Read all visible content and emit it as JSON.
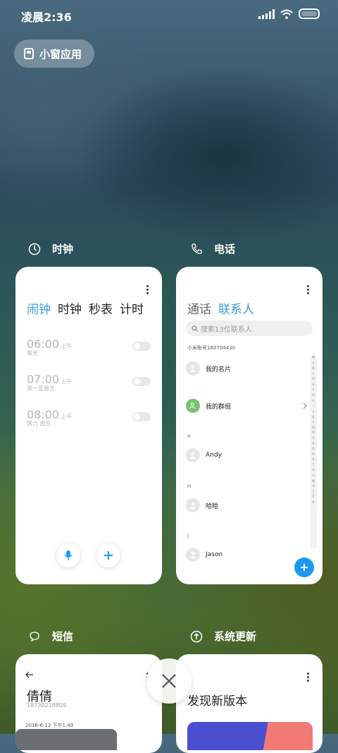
{
  "status_bar": {
    "time": "凌晨2:36"
  },
  "floating_window": {
    "label": "小窗应用",
    "icon": "small-window-icon"
  },
  "colors": {
    "accent": "#3a9bdc",
    "fab": "#1a9aef",
    "contact_group": "#78c26f"
  },
  "cards": {
    "clock": {
      "title": "时钟",
      "icon": "clock-icon",
      "tabs": [
        "闹钟",
        "时钟",
        "秒表",
        "计时"
      ],
      "active_tab": "闹钟",
      "alarms": [
        {
          "time": "06:00",
          "ampm": "上午",
          "repeat": "每天",
          "enabled": false
        },
        {
          "time": "07:00",
          "ampm": "上午",
          "repeat": "周一至周五",
          "enabled": false
        },
        {
          "time": "08:00",
          "ampm": "上午",
          "repeat": "周六 周日",
          "enabled": false
        }
      ]
    },
    "phone": {
      "title": "电话",
      "icon": "phone-icon",
      "tabs": [
        "通话",
        "联系人"
      ],
      "active_tab": "联系人",
      "search_placeholder": "搜索13位联系人",
      "account": "小米账号183704430",
      "contacts": [
        {
          "letter": "",
          "name": "我的名片"
        },
        {
          "letter": "",
          "name": "我的群组"
        },
        {
          "letter": "A",
          "name": "Andy"
        },
        {
          "letter": "H",
          "name": "哈哈"
        },
        {
          "letter": "J",
          "name": "Jason"
        }
      ],
      "index_letters": [
        "♥",
        "A",
        "B",
        "C",
        "D",
        "E",
        "F",
        "G",
        "H",
        "I",
        "J",
        "K",
        "L",
        "M",
        "N",
        "O",
        "P",
        "Q",
        "R",
        "S",
        "T",
        "U",
        "V",
        "W",
        "X",
        "Y",
        "Z",
        "#"
      ]
    },
    "sms": {
      "title": "短信",
      "icon": "message-icon",
      "contact_name": "倩倩",
      "contact_number": "18730218809",
      "date": "2016-6-13 下午1:49"
    },
    "update": {
      "title": "系统更新",
      "icon": "update-icon",
      "heading": "发现新版本"
    }
  },
  "close_button": {
    "icon": "close-icon"
  }
}
